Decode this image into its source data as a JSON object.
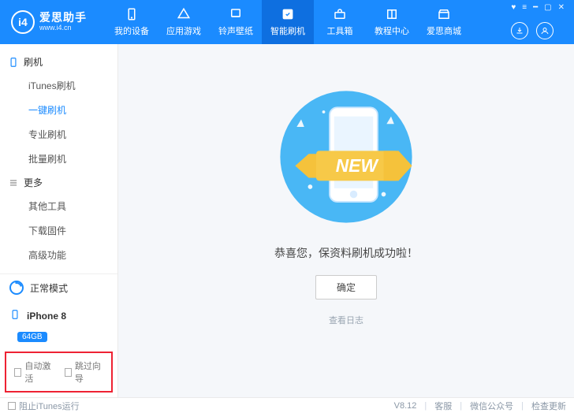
{
  "header": {
    "logo_title": "爱思助手",
    "logo_sub": "www.i4.cn",
    "nav": [
      {
        "label": "我的设备",
        "icon": "phone"
      },
      {
        "label": "应用游戏",
        "icon": "apps"
      },
      {
        "label": "铃声壁纸",
        "icon": "note"
      },
      {
        "label": "智能刷机",
        "icon": "flash",
        "active": true
      },
      {
        "label": "工具箱",
        "icon": "toolbox"
      },
      {
        "label": "教程中心",
        "icon": "book"
      },
      {
        "label": "爱思商城",
        "icon": "shop"
      }
    ]
  },
  "sidebar": {
    "group1_title": "刷机",
    "group1_items": [
      "iTunes刷机",
      "一键刷机",
      "专业刷机",
      "批量刷机"
    ],
    "group1_active_index": 1,
    "group2_title": "更多",
    "group2_items": [
      "其他工具",
      "下载固件",
      "高级功能"
    ],
    "mode_label": "正常模式",
    "device_name": "iPhone 8",
    "device_capacity": "64GB",
    "cb_auto_activate": "自动激活",
    "cb_skip_guide": "跳过向导"
  },
  "main": {
    "success_text": "恭喜您，保资料刷机成功啦！",
    "ok_button": "确定",
    "view_log": "查看日志"
  },
  "footer": {
    "block_itunes": "阻止iTunes运行",
    "version": "V8.12",
    "support": "客服",
    "wechat": "微信公众号",
    "check_update": "检查更新"
  }
}
